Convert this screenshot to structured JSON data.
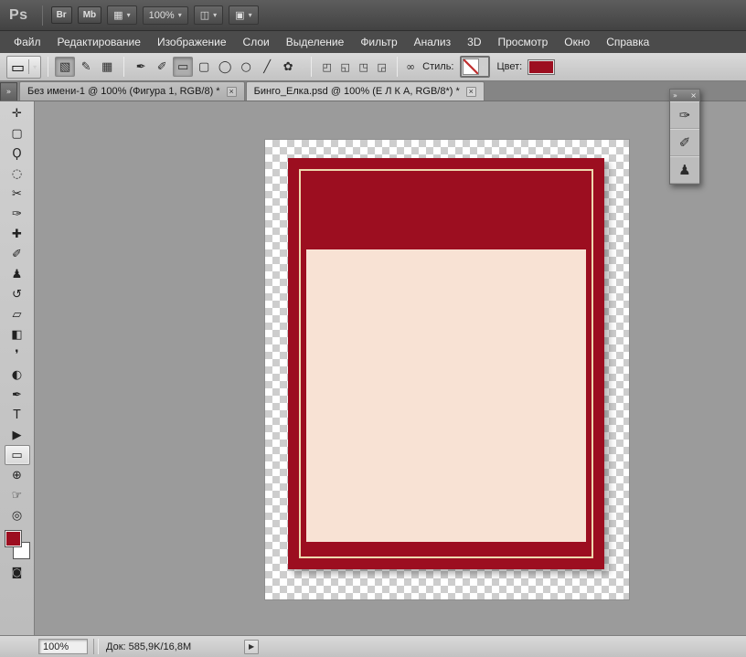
{
  "titlebar": {
    "logo": "Ps",
    "bridge_button": "Br",
    "minibridge_button": "Mb",
    "view_extras_icon": "▦",
    "zoom_level": "100%",
    "arrange_documents_icon": "◫",
    "screen_mode_icon": "▣",
    "caret": "▾"
  },
  "menubar": {
    "items": [
      {
        "name": "menu-file",
        "label": "Файл"
      },
      {
        "name": "menu-edit",
        "label": "Редактирование"
      },
      {
        "name": "menu-image",
        "label": "Изображение"
      },
      {
        "name": "menu-layers",
        "label": "Слои"
      },
      {
        "name": "menu-select",
        "label": "Выделение"
      },
      {
        "name": "menu-filter",
        "label": "Фильтр"
      },
      {
        "name": "menu-analysis",
        "label": "Анализ"
      },
      {
        "name": "menu-3d",
        "label": "3D"
      },
      {
        "name": "menu-view",
        "label": "Просмотр"
      },
      {
        "name": "menu-window",
        "label": "Окно"
      },
      {
        "name": "menu-help",
        "label": "Справка"
      }
    ]
  },
  "options": {
    "tool_preset_icon": "▭",
    "caret": "▾",
    "mode_buttons": [
      {
        "name": "shape-layers-button",
        "glyph": "▧",
        "pressed": true
      },
      {
        "name": "paths-button",
        "glyph": "✎",
        "pressed": false
      },
      {
        "name": "fill-pixels-button",
        "glyph": "▦",
        "pressed": false
      }
    ],
    "shape_buttons": [
      {
        "name": "pen-tool-button",
        "glyph": "✒",
        "pressed": false
      },
      {
        "name": "freeform-pen-tool-button",
        "glyph": "✐",
        "pressed": false
      },
      {
        "name": "rectangle-tool-button",
        "glyph": "▭",
        "pressed": true
      },
      {
        "name": "rounded-rectangle-tool-button",
        "glyph": "▢",
        "pressed": false
      },
      {
        "name": "ellipse-tool-button",
        "glyph": "◯",
        "pressed": false
      },
      {
        "name": "polygon-tool-button",
        "glyph": "○",
        "pressed": false
      },
      {
        "name": "line-tool-button",
        "glyph": "╱",
        "pressed": false
      },
      {
        "name": "custom-shape-tool-button",
        "glyph": "✿",
        "pressed": false
      }
    ],
    "path_op_buttons": [
      {
        "name": "create-shape-layer-button",
        "glyph": "◰",
        "pressed": false
      },
      {
        "name": "add-to-shape-button",
        "glyph": "◱",
        "pressed": false
      },
      {
        "name": "subtract-from-shape-button",
        "glyph": "◳",
        "pressed": false
      },
      {
        "name": "intersect-shape-button",
        "glyph": "◲",
        "pressed": false
      }
    ],
    "link_icon": "∞",
    "style_label": "Стиль:",
    "color_label": "Цвет:",
    "shape_color": "#9c0e20"
  },
  "tabs": [
    {
      "name": "tab-untitled-1",
      "label": "Без имени-1 @ 100% (Фигура 1, RGB/8) *",
      "close_glyph": "×",
      "active": false
    },
    {
      "name": "tab-bingo-elka",
      "label": "Бинго_Елка.psd @ 100% (Е Л К А, RGB/8*) *",
      "close_glyph": "×",
      "active": true
    }
  ],
  "tools_panel": {
    "collapse_glyph": "»",
    "tools": [
      {
        "name": "move-tool",
        "glyph": "✛",
        "selected": false
      },
      {
        "name": "rectangular-marquee-tool",
        "glyph": "▢",
        "selected": false
      },
      {
        "name": "lasso-tool",
        "glyph": "Ϙ",
        "selected": false
      },
      {
        "name": "quick-selection-tool",
        "glyph": "◌",
        "selected": false
      },
      {
        "name": "crop-tool",
        "glyph": "✂",
        "selected": false
      },
      {
        "name": "eyedropper-tool",
        "glyph": "✑",
        "selected": false
      },
      {
        "name": "spot-healing-brush-tool",
        "glyph": "✚",
        "selected": false
      },
      {
        "name": "brush-tool",
        "glyph": "✐",
        "selected": false
      },
      {
        "name": "clone-stamp-tool",
        "glyph": "♟",
        "selected": false
      },
      {
        "name": "history-brush-tool",
        "glyph": "↺",
        "selected": false
      },
      {
        "name": "eraser-tool",
        "glyph": "▱",
        "selected": false
      },
      {
        "name": "gradient-tool",
        "glyph": "◧",
        "selected": false
      },
      {
        "name": "blur-tool",
        "glyph": "❜",
        "selected": false
      },
      {
        "name": "dodge-tool",
        "glyph": "◐",
        "selected": false
      },
      {
        "name": "pen-tool",
        "glyph": "✒",
        "selected": false
      },
      {
        "name": "type-tool",
        "glyph": "T",
        "selected": false
      },
      {
        "name": "path-selection-tool",
        "glyph": "▶",
        "selected": false
      },
      {
        "name": "rectangle-tool",
        "glyph": "▭",
        "selected": true
      },
      {
        "name": "3d-rotate-tool",
        "glyph": "⊕",
        "selected": false
      },
      {
        "name": "hand-tool",
        "glyph": "☞",
        "selected": false
      },
      {
        "name": "zoom-tool",
        "glyph": "◎",
        "selected": false
      }
    ],
    "foreground_color": "#9c0e20",
    "background_color": "#ffffff",
    "quick_mask_glyph": "◙"
  },
  "float_panel": {
    "collapse_glyph": "»",
    "close_glyph": "×",
    "icons": [
      {
        "name": "tool-presets-panel-icon",
        "glyph": "✑"
      },
      {
        "name": "brush-panel-icon",
        "glyph": "✐"
      },
      {
        "name": "clone-source-panel-icon",
        "glyph": "♟"
      }
    ]
  },
  "canvas": {
    "checker_light": "#ffffff",
    "checker_dark": "#cdcdcd",
    "card_color": "#9c0e20",
    "outline_color": "#eed9ae",
    "inner_rect_color": "#f8e2d4"
  },
  "statusbar": {
    "zoom": "100%",
    "doc_info": "Док: 585,9K/16,8M",
    "expand_glyph": "▶"
  }
}
